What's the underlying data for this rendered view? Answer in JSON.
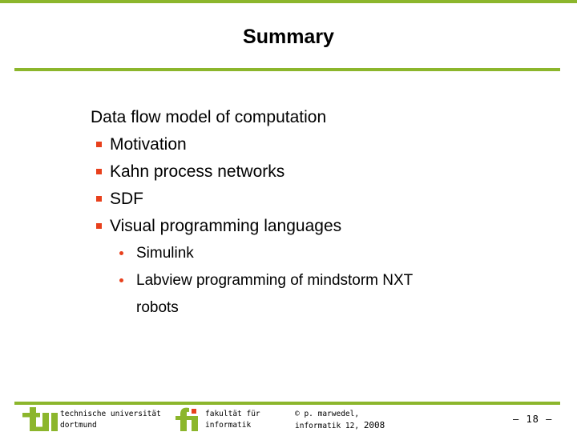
{
  "slide": {
    "title": "Summary",
    "page_marker": "– 18 –",
    "accent_green": "#8CB62C",
    "bullet_orange": "#E8401C"
  },
  "content": {
    "lead": "Data flow model of computation",
    "bullets": [
      {
        "label": "Motivation",
        "marker": "square-bullet-icon"
      },
      {
        "label": "Kahn process networks",
        "marker": "square-bullet-icon"
      },
      {
        "label": "SDF",
        "marker": "square-bullet-icon"
      },
      {
        "label": "Visual programming languages",
        "marker": "square-bullet-icon"
      }
    ],
    "sub_bullets": [
      {
        "line1": "Simulink",
        "line2": "",
        "marker": "dot-bullet-icon"
      },
      {
        "line1": "Labview programming of mindstorm NXT",
        "line2": "robots",
        "marker": "dot-bullet-icon"
      }
    ]
  },
  "footer": {
    "tu_logo_name": "tu-dortmund-logo",
    "tu_line1": "technische universität",
    "tu_line2": "dortmund",
    "fi_logo_name": "fakultaet-informatik-logo",
    "fi_line1": "fakultät für",
    "fi_line2": "informatik",
    "copy_line1": "© p. marwedel,",
    "copy_line2_prefix": "informatik 12,",
    "copy_year": "2008"
  }
}
